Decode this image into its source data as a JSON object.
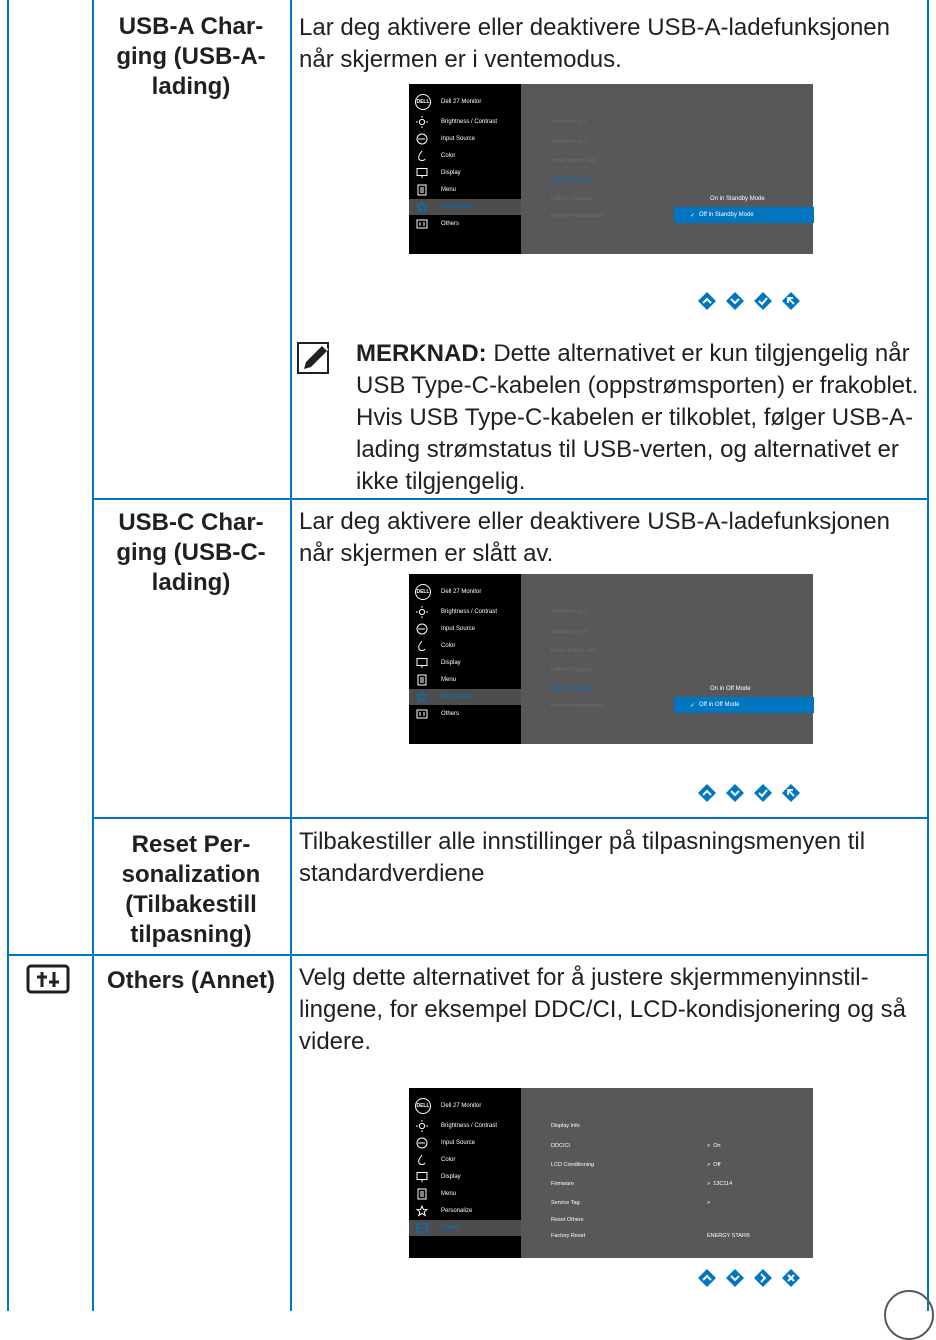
{
  "rows": [
    {
      "setting_lines": [
        "USB-A Char-",
        "ging (USB-A-",
        "lading)"
      ],
      "description": "Lar deg aktivere eller deaktivere USB-A-ladefunksjonen når skjermen er i ventemodus."
    },
    {
      "setting_lines": [
        "USB-C Char-",
        "ging (USB-C-",
        "lading)"
      ],
      "description": "Lar deg aktivere eller deaktivere USB-A-ladefunksjonen når skjermen er slått av."
    },
    {
      "setting_lines": [
        "Reset Per-",
        "sonalization",
        "(Tilbakestill",
        "tilpasning)"
      ],
      "description": "Tilbakestiller alle innstillinger på tilpasningsmenyen til standardverdiene"
    },
    {
      "setting_lines": [
        "Others (Annet)"
      ],
      "description": "Velg dette alternativet for å justere skjermmenyinnstil-lingene, for eksempel DDC/CI, LCD-kondisjonering og så videre."
    }
  ],
  "note": {
    "label": "MERKNAD:",
    "text": " Dette alternativet er kun tilgjengelig når USB Type-C-kabelen (oppstrømsporten) er frakoblet. Hvis USB Type-C-kabelen er tilkoblet, følger USB-A-lading strømstatus til USB-verten, og alternativet er ikke tilgjengelig."
  },
  "osd": {
    "logo": "DELL",
    "title": "Dell 27 Monitor",
    "menu": [
      "Brightness / Contrast",
      "Input Source",
      "Color",
      "Display",
      "Menu",
      "Personalize",
      "Others"
    ],
    "personalize_items": [
      "Shortcut Key 1",
      "Shortcut Key 2",
      "Power Button LED",
      "USB-A Charging",
      "USB-C Charging",
      "Reset Personalization"
    ],
    "usba_options": [
      "On in Standby Mode",
      "Off in Standby Mode"
    ],
    "usbc_options": [
      "On in Off Mode",
      "Off in Off Mode"
    ],
    "others_items": [
      "Display Info",
      "DDC/CI",
      "LCD Conditioning",
      "Firmware",
      "Service Tag",
      "Reset Others",
      "Factory Reset"
    ],
    "others_values": [
      "On",
      "Off",
      "13C114",
      ""
    ],
    "energy_star": "ENERGY STAR®",
    "value_prefix": ">"
  },
  "colors": {
    "accent": "#0076c0",
    "osd_panel": "#58585a",
    "osd_menu": "#000000"
  }
}
